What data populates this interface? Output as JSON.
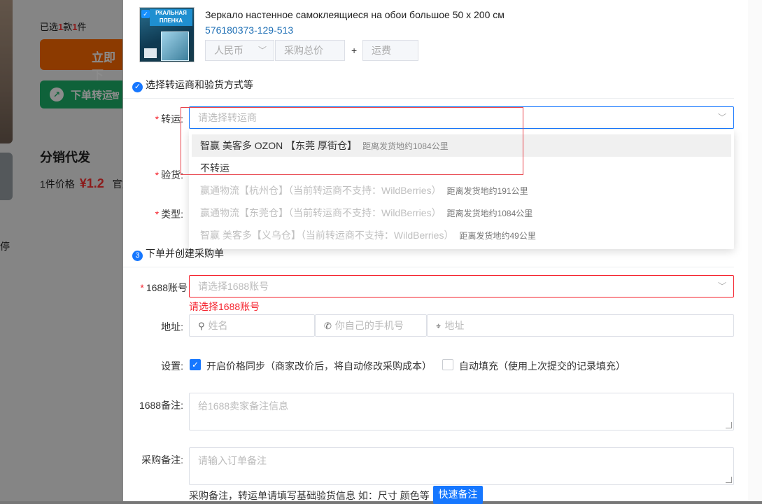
{
  "background": {
    "selected_prefix": "已选",
    "selected_count1": "1",
    "selected_mid": "款",
    "selected_count2": "1",
    "selected_suffix": "件",
    "order_button": "立即下",
    "transfer_button": "下单转运",
    "transfer_small": "智",
    "distribution_title": "分销代发",
    "price_label": "1件价格",
    "price_value": "¥1.2",
    "price_suffix": "官方",
    "side_char": "停"
  },
  "product": {
    "title": "Зеркало настенное самоклеящиеся на обои большое 50 х 200 см",
    "sku": "576180373-129-513",
    "image_band_text": "РКАЛЬНАЯ ПЛЕНКА",
    "currency": "人民币",
    "total_price_placeholder": "采购总价",
    "plus": "+",
    "shipping_placeholder": "运费"
  },
  "section2": {
    "title": "选择转运商和验货方式等"
  },
  "form": {
    "transfer_label": "转运:",
    "transfer_placeholder": "请选择转运商",
    "inspect_label": "验货:",
    "type_label": "类型:"
  },
  "dropdown": {
    "items": [
      {
        "name": "智赢 美客多 OZON 【东莞 厚街仓】",
        "distance": "距离发货地约1084公里",
        "state": "hover"
      },
      {
        "name": "不转运",
        "distance": "",
        "state": "normal"
      },
      {
        "name": "赢通物流【杭州仓】（当前转运商不支持：WildBerries）",
        "distance": "距离发货地约191公里",
        "state": "disabled"
      },
      {
        "name": "赢通物流【东莞仓】（当前转运商不支持：WildBerries）",
        "distance": "距离发货地约1084公里",
        "state": "disabled"
      },
      {
        "name": "智赢 美客多【义乌仓】（当前转运商不支持：WildBerries）",
        "distance": "距离发货地约49公里",
        "state": "disabled"
      }
    ]
  },
  "section3": {
    "number": "3",
    "title": "下单并创建采购单"
  },
  "account": {
    "label": "1688账号",
    "placeholder": "请选择1688账号",
    "error": "请选择1688账号"
  },
  "address": {
    "label": "地址:",
    "name_placeholder": "姓名",
    "phone_placeholder": "你自己的手机号",
    "address_placeholder": "地址"
  },
  "settings": {
    "label": "设置:",
    "price_sync": "开启价格同步（商家改价后，将自动修改采购成本）",
    "price_sync_checked": true,
    "autofill": "自动填充（使用上次提交的记录填充）",
    "autofill_checked": false
  },
  "note1688": {
    "label": "1688备注:",
    "placeholder": "给1688卖家备注信息"
  },
  "purchase_note": {
    "label": "采购备注:",
    "placeholder": "请输入订单备注"
  },
  "hint": {
    "text": "采购备注，转运单请填写基础验货信息 如：尺寸 颜色等",
    "quick_button": "快速备注"
  },
  "colors": {
    "primary": "#1677ff",
    "error": "#f5222d",
    "highlight_outline": "#e8424a"
  }
}
